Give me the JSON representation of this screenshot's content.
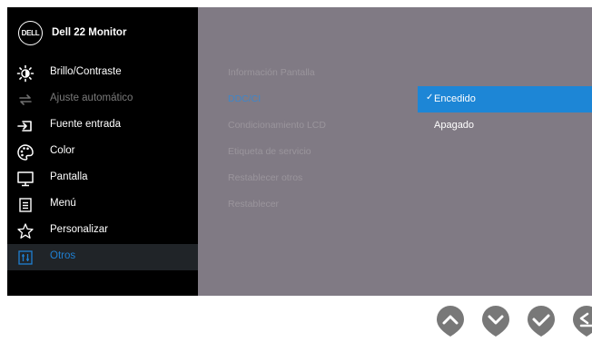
{
  "header": {
    "logo_text": "DELL",
    "title": "Dell 22 Monitor"
  },
  "menu": {
    "items": [
      {
        "label": "Brillo/Contraste",
        "icon": "brightness-icon",
        "state": "normal"
      },
      {
        "label": "Ajuste automático",
        "icon": "auto-adjust-icon",
        "state": "disabled"
      },
      {
        "label": "Fuente entrada",
        "icon": "input-source-icon",
        "state": "normal"
      },
      {
        "label": "Color",
        "icon": "color-palette-icon",
        "state": "normal"
      },
      {
        "label": "Pantalla",
        "icon": "display-icon",
        "state": "normal"
      },
      {
        "label": "Menú",
        "icon": "menu-icon",
        "state": "normal"
      },
      {
        "label": "Personalizar",
        "icon": "star-icon",
        "state": "normal"
      },
      {
        "label": "Otros",
        "icon": "others-icon",
        "state": "active"
      }
    ]
  },
  "submenu": {
    "items": [
      "Información Pantalla",
      "DDC/CI",
      "Condicionamiento LCD",
      "Etiqueta de servicio",
      "Restablecer otros",
      "Restablecer"
    ],
    "active": "DDC/CI"
  },
  "options": {
    "check_mark": "✓",
    "items": [
      "Encedido",
      "Apagado"
    ],
    "selected": "Encedido"
  },
  "buttons": [
    "up-button",
    "down-button",
    "ok-button",
    "back-button"
  ],
  "colors": {
    "osd_background": "#807a84",
    "panel_background": "#000000",
    "accent": "#1d86d6",
    "active_text": "#1f7fd1"
  }
}
